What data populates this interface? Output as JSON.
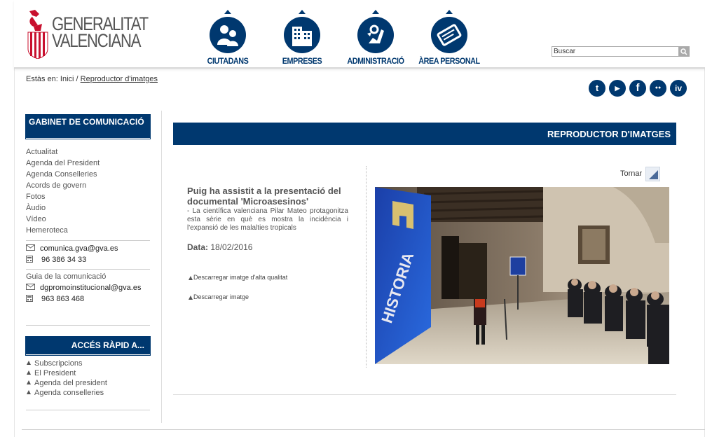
{
  "header": {
    "logo_line1": "GENERALITAT",
    "logo_line2": "VALENCIANA",
    "nav": [
      {
        "label": "CIUTADANS",
        "icon": "citizens-icon"
      },
      {
        "label": "EMPRESES",
        "icon": "building-icon"
      },
      {
        "label": "ADMINISTRACIÓ",
        "icon": "administration-icon"
      },
      {
        "label": "ÀREA PERSONAL",
        "icon": "personal-area-icon"
      }
    ],
    "search_value": "Buscar"
  },
  "breadcrumb": {
    "prefix": "Estàs en:",
    "home": "Inici",
    "separator": "/",
    "current": "Reproductor d'imatges"
  },
  "social": [
    {
      "icon": "twitter-icon",
      "glyph": "t"
    },
    {
      "icon": "youtube-icon",
      "glyph": "▶"
    },
    {
      "icon": "facebook-icon",
      "glyph": "f"
    },
    {
      "icon": "flickr-icon",
      "glyph": "●●"
    },
    {
      "icon": "iv-icon",
      "glyph": "iv"
    }
  ],
  "sidebar": {
    "section1_title": "GABINET DE COMUNICACIÓ",
    "items": [
      "Actualitat",
      "Agenda del President",
      "Agenda Conselleries",
      "Acords de govern",
      "Fotos",
      "Àudio",
      "Vídeo",
      "Hemeroteca"
    ],
    "contact1": {
      "email": "comunica.gva@gva.es",
      "phone": "96 386 34 33"
    },
    "guide_label": "Guia de la comunicació",
    "contact2": {
      "email": "dgpromoinstitucional@gva.es",
      "phone": "963 863 468"
    },
    "section2_title": "ACCÉS RÀPID A...",
    "quick": [
      "Subscripcions",
      "El President",
      "Agenda del president",
      "Agenda conselleries"
    ]
  },
  "main": {
    "title": "REPRODUCTOR D'IMATGES",
    "back_label": "Tornar",
    "article_title": "Puig ha assistit a la presentació del documental 'Microasesinos'",
    "article_subtitle": "- La científica valenciana Pilar Mateo protagonitza esta sèrie en què es mostra la incidència i l'expansió de les malalties tropicals",
    "date_label": "Data:",
    "date_value": "18/02/2016",
    "download_hq": "Descarregar imatge d'alta qualitat",
    "download": "Descarregar imatge"
  },
  "colors": {
    "brand_blue": "#00386f",
    "gva_red": "#c8102e"
  }
}
